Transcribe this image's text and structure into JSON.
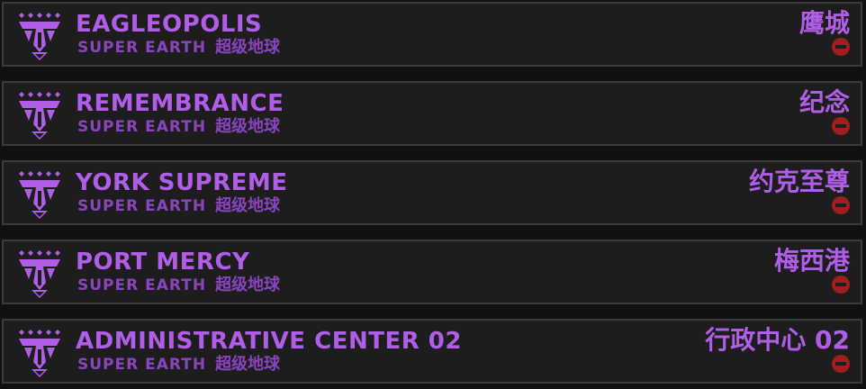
{
  "colors": {
    "accent": "#b05ee8",
    "accent_dim": "#8a45bd",
    "danger": "#a01e1e",
    "background": "#111111",
    "card": "#1d1d1d",
    "border": "#3b3b3b"
  },
  "emblem_icon": "super-earth-emblem-icon",
  "status_icon": "remove-icon",
  "cities": [
    {
      "name": "EAGLEOPOLIS",
      "planet": "SUPER EARTH",
      "planet_cn": "超级地球",
      "name_cn": "鹰城"
    },
    {
      "name": "REMEMBRANCE",
      "planet": "SUPER EARTH",
      "planet_cn": "超级地球",
      "name_cn": "纪念"
    },
    {
      "name": "YORK SUPREME",
      "planet": "SUPER EARTH",
      "planet_cn": "超级地球",
      "name_cn": "约克至尊"
    },
    {
      "name": "PORT MERCY",
      "planet": "SUPER EARTH",
      "planet_cn": "超级地球",
      "name_cn": "梅西港"
    },
    {
      "name": "ADMINISTRATIVE CENTER 02",
      "planet": "SUPER EARTH",
      "planet_cn": "超级地球",
      "name_cn": "行政中心 02"
    }
  ]
}
